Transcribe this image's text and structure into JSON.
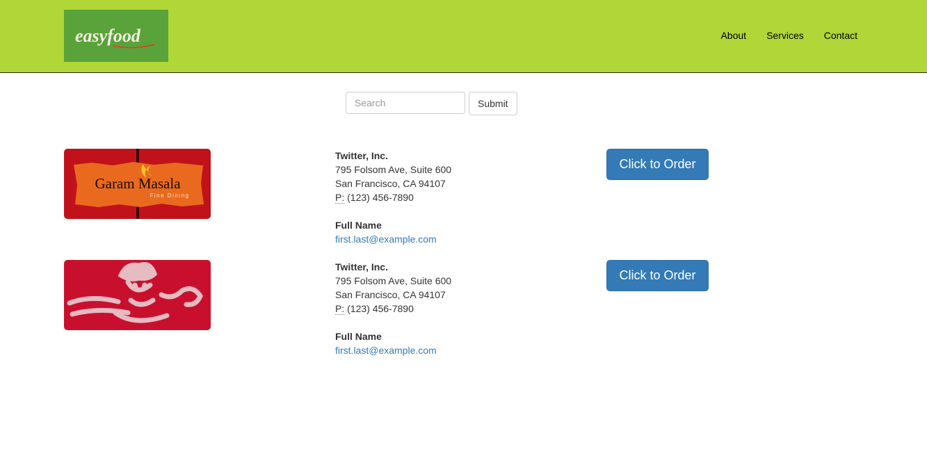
{
  "brand": {
    "logo_text": "easyfood"
  },
  "nav": [
    {
      "label": "About"
    },
    {
      "label": "Services"
    },
    {
      "label": "Contact"
    }
  ],
  "search": {
    "placeholder": "Search",
    "value": "",
    "submit_label": "Submit"
  },
  "restaurants": [
    {
      "image_text": "Garam Masala",
      "image_subtext": "Fine Dining",
      "company": "Twitter, Inc.",
      "address1": "795 Folsom Ave, Suite 600",
      "address2": "San Francisco, CA 94107",
      "phone_label": "P:",
      "phone": "(123) 456-7890",
      "contact_name": "Full Name",
      "email": "first.last@example.com",
      "order_label": "Click to Order"
    },
    {
      "image_text": "",
      "image_subtext": "",
      "company": "Twitter, Inc.",
      "address1": "795 Folsom Ave, Suite 600",
      "address2": "San Francisco, CA 94107",
      "phone_label": "P:",
      "phone": "(123) 456-7890",
      "contact_name": "Full Name",
      "email": "first.last@example.com",
      "order_label": "Click to Order"
    }
  ],
  "colors": {
    "header_bg": "#b0d637",
    "logo_bg": "#5aa23a",
    "button_bg": "#337ab7",
    "link": "#337ab7"
  }
}
